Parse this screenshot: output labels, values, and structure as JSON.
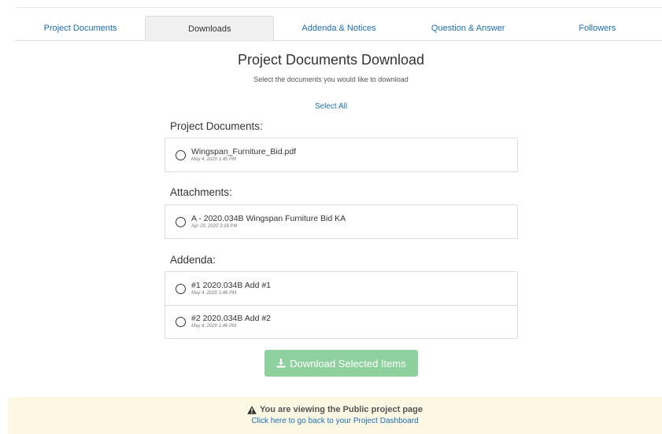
{
  "tabs": [
    {
      "label": "Project Documents",
      "active": false
    },
    {
      "label": "Downloads",
      "active": true
    },
    {
      "label": "Addenda & Notices",
      "active": false
    },
    {
      "label": "Question & Answer",
      "active": false
    },
    {
      "label": "Followers",
      "active": false
    }
  ],
  "page": {
    "title": "Project Documents Download",
    "subtitle": "Select the documents you would like to download",
    "select_all": "Select All"
  },
  "sections": {
    "project_documents": {
      "label": "Project Documents:",
      "items": [
        {
          "name": "Wingspan_Furniture_Bid.pdf",
          "date": "May 4, 2020 1:45 PM"
        }
      ]
    },
    "attachments": {
      "label": "Attachments:",
      "items": [
        {
          "name": "A - 2020.034B Wingspan Furniture Bid KA",
          "date": "Apr 29, 2020 3:18 PM"
        }
      ]
    },
    "addenda": {
      "label": "Addenda:",
      "items": [
        {
          "name": "#1 2020.034B Add #1",
          "date": "May 4, 2020 1:46 PM"
        },
        {
          "name": "#2 2020.034B Add #2",
          "date": "May 4, 2020 1:46 PM"
        }
      ]
    }
  },
  "download_button": {
    "label": "Download Selected Items",
    "icon": "download-icon"
  },
  "notice": {
    "icon": "warning-icon",
    "message": "You are viewing the Public project page",
    "link": "Click here to go back to your Project Dashboard"
  },
  "colors": {
    "link": "#1b6fb5",
    "button": "#8fd19e",
    "notice_bg": "#fcf8e3"
  }
}
